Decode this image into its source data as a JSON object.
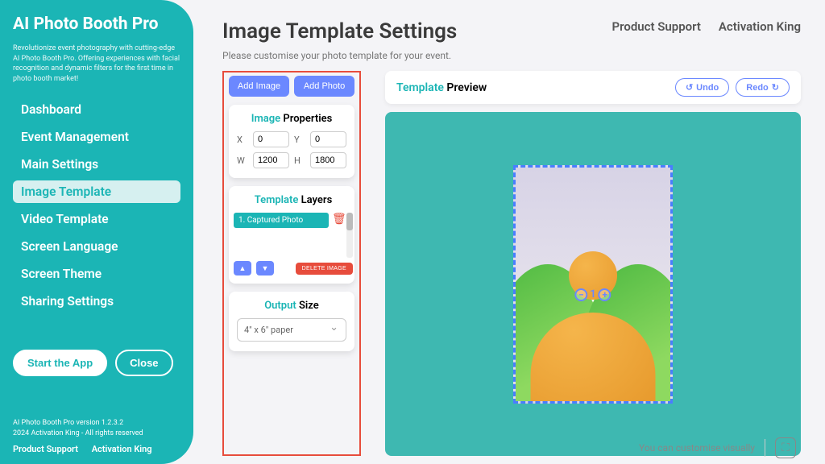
{
  "sidebar": {
    "appName": "AI Photo Booth Pro",
    "tagline": "Revolutionize event photography with cutting-edge AI Photo Booth Pro. Offering experiences with facial recognition and dynamic filters for the first time in photo booth market!",
    "nav": {
      "dashboard": "Dashboard",
      "event": "Event Management",
      "mainSettings": "Main Settings",
      "imageTemplate": "Image Template",
      "videoTemplate": "Video Template",
      "screenLanguage": "Screen Language",
      "screenTheme": "Screen Theme",
      "sharing": "Sharing Settings"
    },
    "startBtn": "Start the App",
    "closeBtn": "Close",
    "version": "AI Photo Booth Pro version 1.2.3.2",
    "copyright": "2024 Activation King - All rights reserved",
    "link1": "Product Support",
    "link2": "Activation King"
  },
  "header": {
    "title": "Image Template Settings",
    "subtitle": "Please customise your photo template for your event.",
    "link1": "Product Support",
    "link2": "Activation King"
  },
  "panel": {
    "addImage": "Add Image",
    "addPhoto": "Add Photo",
    "imgPropsAccent": "Image",
    "imgPropsRest": " Properties",
    "labels": {
      "x": "X",
      "y": "Y",
      "w": "W",
      "h": "H"
    },
    "values": {
      "x": "0",
      "y": "0",
      "w": "1200",
      "h": "1800"
    },
    "layersAccent": "Template",
    "layersRest": " Layers",
    "layer1": "1. Captured Photo",
    "deleteImage": "DELETE IMAGE",
    "outputAccent": "Output",
    "outputRest": " Size",
    "outputValue": "4\" x 6\" paper"
  },
  "preview": {
    "titleAccent": "Template",
    "titleRest": " Preview",
    "undo": "Undo",
    "redo": "Redo",
    "indicatorNum": "1"
  },
  "footerNote": "You can customise visually"
}
